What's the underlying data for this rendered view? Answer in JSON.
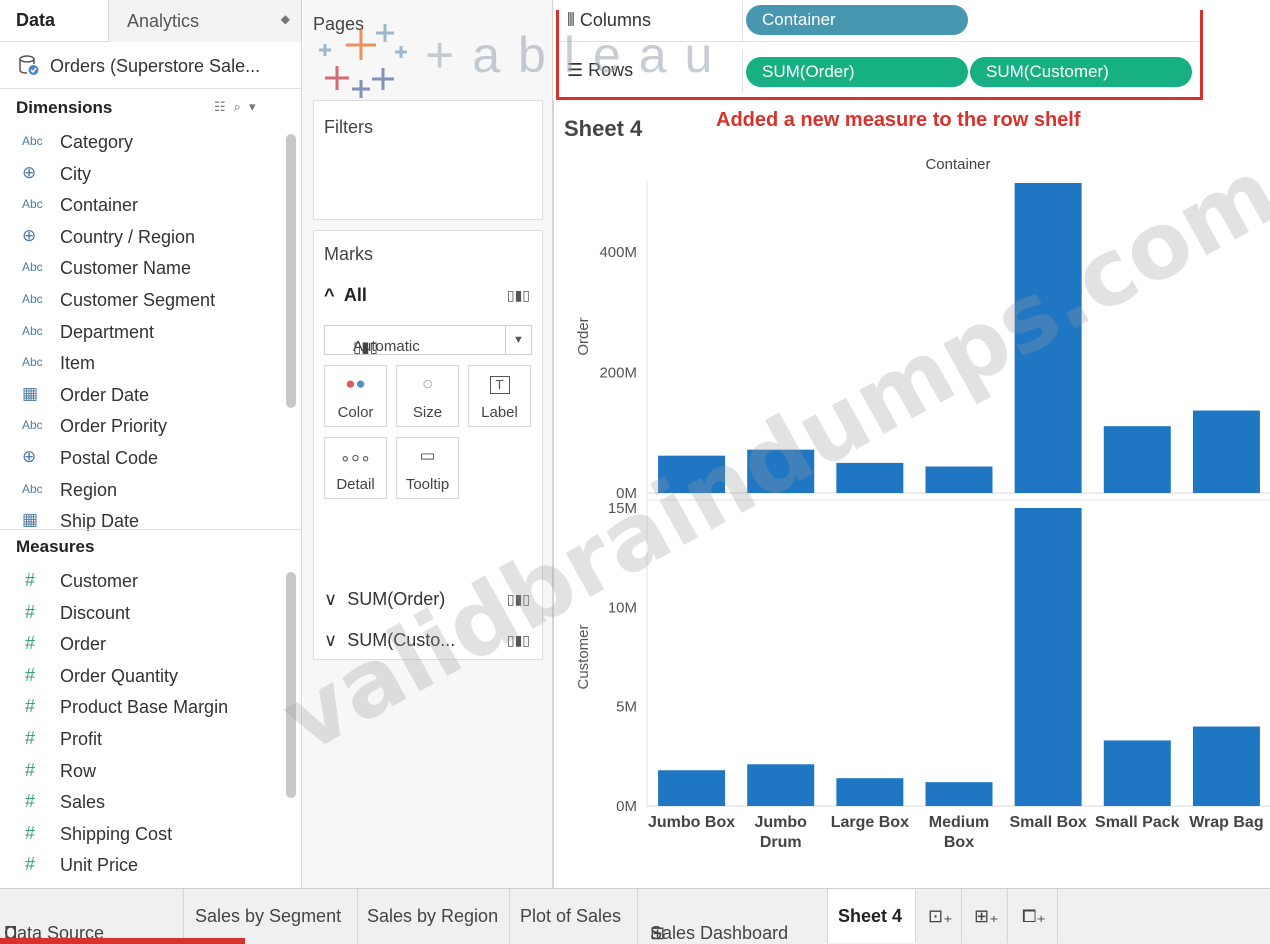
{
  "data_pane": {
    "tab_data": "Data",
    "tab_analytics": "Analytics",
    "datasource": "Orders (Superstore Sale...",
    "dimensions_header": "Dimensions",
    "dimensions": [
      {
        "type": "Abc",
        "label": "Category",
        "icon": "text-type-icon"
      },
      {
        "type": "globe",
        "label": "City",
        "icon": "globe-icon"
      },
      {
        "type": "Abc",
        "label": "Container",
        "icon": "text-type-icon"
      },
      {
        "type": "globe",
        "label": "Country / Region",
        "icon": "globe-icon"
      },
      {
        "type": "Abc",
        "label": "Customer Name",
        "icon": "text-type-icon"
      },
      {
        "type": "Abc",
        "label": "Customer Segment",
        "icon": "text-type-icon"
      },
      {
        "type": "Abc",
        "label": "Department",
        "icon": "text-type-icon"
      },
      {
        "type": "Abc",
        "label": "Item",
        "icon": "text-type-icon"
      },
      {
        "type": "date",
        "label": "Order Date",
        "icon": "calendar-icon"
      },
      {
        "type": "Abc",
        "label": "Order Priority",
        "icon": "text-type-icon"
      },
      {
        "type": "globe",
        "label": "Postal Code",
        "icon": "globe-icon"
      },
      {
        "type": "Abc",
        "label": "Region",
        "icon": "text-type-icon"
      },
      {
        "type": "date",
        "label": "Ship Date",
        "icon": "calendar-icon"
      }
    ],
    "measures_header": "Measures",
    "measures": [
      "Customer",
      "Discount",
      "Order",
      "Order Quantity",
      "Product Base Margin",
      "Profit",
      "Row",
      "Sales",
      "Shipping Cost",
      "Unit Price"
    ]
  },
  "cards": {
    "pages": "Pages",
    "filters": "Filters",
    "marks": "Marks",
    "marks_all": "All",
    "mark_type": "Automatic",
    "mark_buttons": [
      {
        "label": "Color",
        "icon": "color-icon"
      },
      {
        "label": "Size",
        "icon": "size-icon"
      },
      {
        "label": "Label",
        "icon": "label-icon"
      },
      {
        "label": "Detail",
        "icon": "detail-icon"
      },
      {
        "label": "Tooltip",
        "icon": "tooltip-icon"
      }
    ],
    "measure_cards": [
      "SUM(Order)",
      "SUM(Custo..."
    ]
  },
  "shelves": {
    "columns_label": "Columns",
    "rows_label": "Rows",
    "columns_pills": [
      "Container"
    ],
    "rows_pills": [
      "SUM(Order)",
      "SUM(Customer)"
    ]
  },
  "sheet": {
    "title": "Sheet 4",
    "annotation": "Added a new measure to the row shelf",
    "annotation_color": "#d8322c"
  },
  "chart_data": {
    "type": "bar",
    "title": "",
    "header_label": "Container",
    "categories": [
      "Jumbo Box",
      "Jumbo Drum",
      "Large Box",
      "Medium Box",
      "Small Box",
      "Small Pack",
      "Wrap Bag"
    ],
    "bar_color": "#1f77c4",
    "grid": false,
    "panes": [
      {
        "name": "Order",
        "ylabel": "Order",
        "ylim": [
          0,
          520
        ],
        "unit": "M",
        "ticks": [
          "0M",
          "200M",
          "400M"
        ],
        "tick_values": [
          0,
          200,
          400
        ],
        "values": [
          62,
          72,
          50,
          44,
          515,
          111,
          137
        ]
      },
      {
        "name": "Customer",
        "ylabel": "Customer",
        "ylim": [
          0,
          15
        ],
        "unit": "M",
        "ticks": [
          "0M",
          "5M",
          "10M",
          "15M"
        ],
        "tick_values": [
          0,
          5,
          10,
          15
        ],
        "values": [
          1.8,
          2.1,
          1.4,
          1.2,
          15.0,
          3.3,
          4.0
        ]
      }
    ]
  },
  "sheet_tabs": [
    {
      "label": "Data Source",
      "icon": "data-source-icon"
    },
    {
      "label": "Sales by Segment"
    },
    {
      "label": "Sales by Region"
    },
    {
      "label": "Plot of Sales"
    },
    {
      "label": "Sales Dashboard",
      "icon": "dashboard-icon"
    },
    {
      "label": "Sheet 4",
      "active": true
    }
  ],
  "logo": "+ableau",
  "watermark": "validbraindumps.com"
}
